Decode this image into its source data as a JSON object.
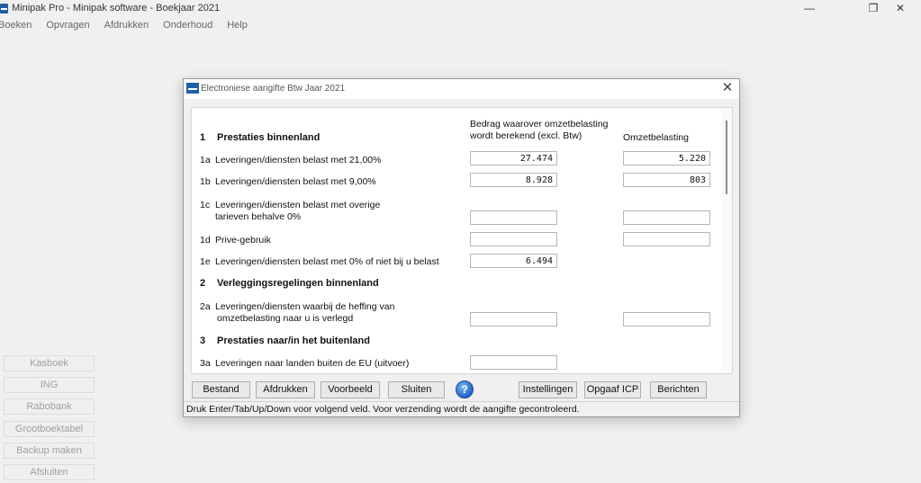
{
  "app": {
    "title": "Minipak Pro - Minipak software - Boekjaar 2021"
  },
  "window_controls": {
    "minimize": "—",
    "restore": "❐",
    "close": "✕"
  },
  "menu": [
    "Boeken",
    "Opvragen",
    "Afdrukken",
    "Onderhoud",
    "Help"
  ],
  "sidebar": [
    "Kasboek",
    "ING",
    "Rabobank",
    "Grootboektabel",
    "Backup maken",
    "Afsluiten"
  ],
  "dialog": {
    "title": "Electroniese aangifte Btw Jaar 2021",
    "close": "✕",
    "col_headers": {
      "amount_line1": "Bedrag waarover omzetbelasting",
      "amount_line2": "wordt berekend (excl. Btw)",
      "tax": "Omzetbelasting"
    },
    "sections": [
      {
        "num": "1",
        "title": "Prestaties binnenland"
      },
      {
        "num": "2",
        "title": "Verleggingsregelingen binnenland"
      },
      {
        "num": "3",
        "title": "Prestaties naar/in het buitenland"
      }
    ],
    "rows": [
      {
        "num": "1a",
        "label": "Leveringen/diensten belast met 21,00%",
        "amount": "27.474",
        "tax": "5.220"
      },
      {
        "num": "1b",
        "label": "Leveringen/diensten belast met 9,00%",
        "amount": "8.928",
        "tax": "803"
      },
      {
        "num": "1c",
        "label": "Leveringen/diensten belast met overige",
        "label2": "tarieven behalve 0%",
        "amount": "",
        "tax": ""
      },
      {
        "num": "1d",
        "label": "Prive-gebruik",
        "amount": "",
        "tax": ""
      },
      {
        "num": "1e",
        "label": "Leveringen/diensten belast met 0% of niet bij u belast",
        "amount": "6.494"
      },
      {
        "num": "2a",
        "label": "Leveringen/diensten waarbij de heffing van",
        "label2": "omzetbelasting naar u is verlegd",
        "amount": "",
        "tax": ""
      },
      {
        "num": "3a",
        "label": "Leveringen naar landen buiten de EU (uitvoer)",
        "amount": ""
      }
    ],
    "buttons": {
      "bestand": "Bestand",
      "afdrukken": "Afdrukken",
      "voorbeeld": "Voorbeeld",
      "sluiten": "Sluiten",
      "help": "?",
      "instellingen": "Instellingen",
      "opgaaf_icp": "Opgaaf ICP",
      "berichten": "Berichten"
    },
    "status": "Druk Enter/Tab/Up/Down voor volgend veld. Voor verzending wordt de aangifte gecontroleerd."
  }
}
